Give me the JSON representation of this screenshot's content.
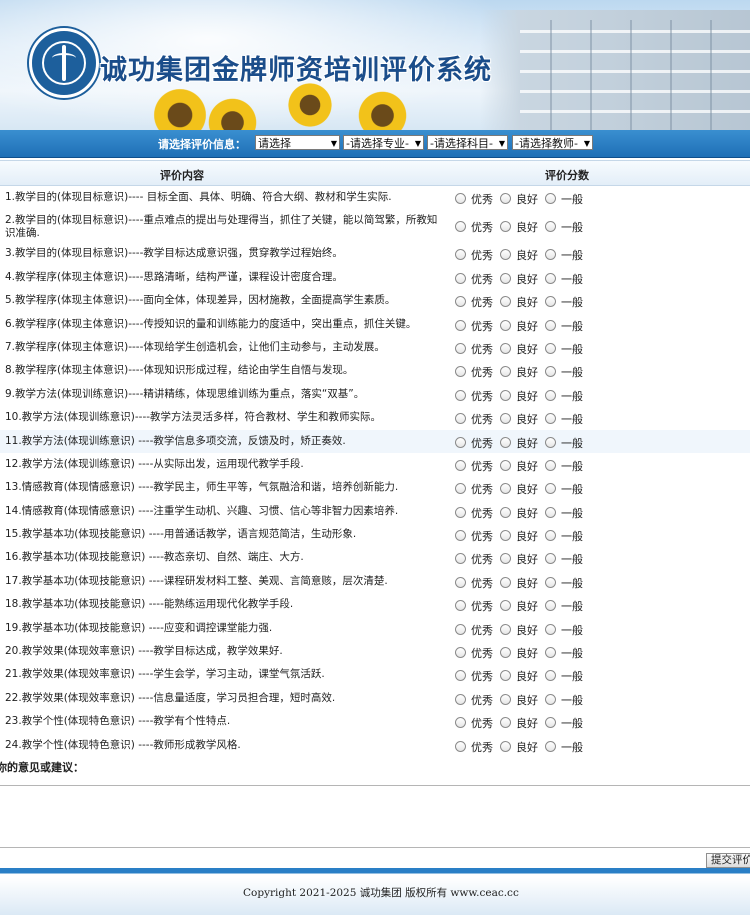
{
  "header": {
    "title": "诚功集团金牌师资培训评价系统",
    "logo_text": "诚功集团"
  },
  "selectors": {
    "label": "请选择评价信息：",
    "items": [
      {
        "value": "请选择"
      },
      {
        "value": "-请选择专业-"
      },
      {
        "value": "-请选择科目-"
      },
      {
        "value": "-请选择教师-"
      }
    ]
  },
  "table": {
    "col_content": "评价内容",
    "col_score": "评价分数",
    "options": [
      "优秀",
      "良好",
      "一般"
    ],
    "rows": [
      {
        "text": "1.教学目的(体现目标意识)---- 目标全面、具体、明确、符合大纲、教材和学生实际."
      },
      {
        "text": "2.教学目的(体现目标意识)----重点难点的提出与处理得当，抓住了关键，能以简驾繁，所教知识准确."
      },
      {
        "text": "3.教学目的(体现目标意识)----教学目标达成意识强，贯穿教学过程始终。"
      },
      {
        "text": "4.教学程序(体现主体意识)----思路清晰，结构严谨，课程设计密度合理。"
      },
      {
        "text": "5.教学程序(体现主体意识)----面向全体，体现差异，因材施教，全面提高学生素质。"
      },
      {
        "text": "6.教学程序(体现主体意识)----传授知识的量和训练能力的度适中，突出重点，抓住关键。"
      },
      {
        "text": "7.教学程序(体现主体意识)----体现给学生创造机会，让他们主动参与，主动发展。"
      },
      {
        "text": "8.教学程序(体现主体意识)----体现知识形成过程，结论由学生自悟与发现。"
      },
      {
        "text": "9.教学方法(体现训练意识)----精讲精练，体现思维训练为重点，落实“双基”。"
      },
      {
        "text": "10.教学方法(体现训练意识)----教学方法灵活多样，符合教材、学生和教师实际。"
      },
      {
        "text": "11.教学方法(体现训练意识) ----教学信息多项交流，反馈及时，矫正奏效."
      },
      {
        "text": "12.教学方法(体现训练意识) ----从实际出发，运用现代教学手段."
      },
      {
        "text": "13.情感教育(体现情感意识) ----教学民主，师生平等，气氛融洽和谐，培养创新能力."
      },
      {
        "text": "14.情感教育(体现情感意识) ----注重学生动机、兴趣、习惯、信心等非智力因素培养."
      },
      {
        "text": "15.教学基本功(体现技能意识) ----用普通话教学，语言规范简洁，生动形象."
      },
      {
        "text": "16.教学基本功(体现技能意识) ----教态亲切、自然、端庄、大方."
      },
      {
        "text": "17.教学基本功(体现技能意识) ----课程研发材料工整、美观、言简意赅，层次清楚."
      },
      {
        "text": "18.教学基本功(体现技能意识) ----能熟练运用现代化教学手段."
      },
      {
        "text": "19.教学基本功(体现技能意识) ----应变和调控课堂能力强."
      },
      {
        "text": "20.教学效果(体现效率意识) ----教学目标达成，教学效果好."
      },
      {
        "text": "21.教学效果(体现效率意识) ----学生会学，学习主动，课堂气氛活跃."
      },
      {
        "text": "22.教学效果(体现效率意识) ----信息量适度，学习员担合理，短时高效."
      },
      {
        "text": "23.教学个性(体现特色意识) ----教学有个性特点."
      },
      {
        "text": "24.教学个性(体现特色意识) ----教师形成教学风格."
      }
    ]
  },
  "comments": {
    "label": "你的意见或建议：",
    "value": ""
  },
  "submit": {
    "label": "提交评价"
  },
  "footer": {
    "copyright": "Copyright 2021-2025 诚功集团 版权所有 www.ceac.cc"
  }
}
